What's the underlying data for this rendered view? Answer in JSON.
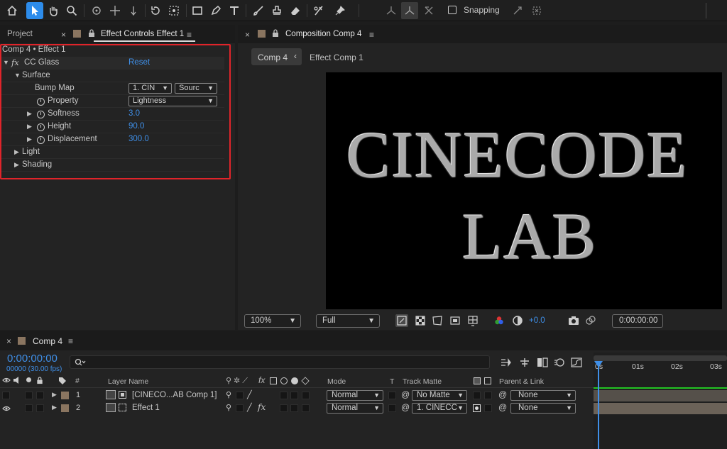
{
  "toolbar": {
    "tools": [
      "home-icon",
      "selection-icon",
      "hand-icon",
      "zoom-icon",
      "orbit-icon",
      "pan-icon",
      "dolly-icon",
      "rotate-icon",
      "pan-behind-icon",
      "rectangle-icon",
      "pen-icon",
      "type-icon",
      "brush-icon",
      "clone-stamp-icon",
      "eraser-icon",
      "roto-brush-icon",
      "puppet-pin-icon"
    ],
    "snapping_label": "Snapping"
  },
  "left_panel": {
    "tabs": {
      "project": "Project",
      "effect_controls": "Effect Controls Effect 1"
    },
    "breadcrumb": "Comp 4 • Effect 1",
    "effect": {
      "fx": "fx",
      "name": "CC Glass",
      "reset": "Reset",
      "surface": "Surface",
      "bump_map": {
        "label": "Bump Map",
        "layer": "1. CIN",
        "source": "Sourc"
      },
      "property": {
        "label": "Property",
        "value": "Lightness"
      },
      "softness": {
        "label": "Softness",
        "value": "3.0"
      },
      "height": {
        "label": "Height",
        "value": "90.0"
      },
      "displacement": {
        "label": "Displacement",
        "value": "300.0"
      },
      "light": "Light",
      "shading": "Shading"
    },
    "highlight_color": "#e0242a"
  },
  "composition": {
    "tab_title": "Composition Comp 4",
    "flow": {
      "current": "Comp 4",
      "next": "Effect Comp 1"
    },
    "viewer_text": {
      "line1": "CINECODE",
      "line2": "LAB"
    },
    "controls": {
      "zoom": "100%",
      "resolution": "Full",
      "exposure": "+0.0",
      "timecode": "0:00:00:00"
    }
  },
  "timeline": {
    "tab": "Comp 4",
    "timecode": "0:00:00:00",
    "frames": "00000 (30.00 fps)",
    "search_placeholder": "",
    "headers": {
      "number": "#",
      "layer_name": "Layer Name",
      "mode": "Mode",
      "t": "T",
      "track_matte": "Track Matte",
      "parent": "Parent & Link"
    },
    "ruler": [
      "0s",
      "01s",
      "02s",
      "03s"
    ],
    "layers": [
      {
        "index": "1",
        "name": "[CINECO...AB Comp 1]",
        "mode": "Normal",
        "matte": "No Matte",
        "parent": "None",
        "fx": ""
      },
      {
        "index": "2",
        "name": "Effect 1",
        "mode": "Normal",
        "matte": "1. CINECC",
        "parent": "None",
        "fx": "fx"
      }
    ],
    "accent": "#3f8fe8"
  }
}
